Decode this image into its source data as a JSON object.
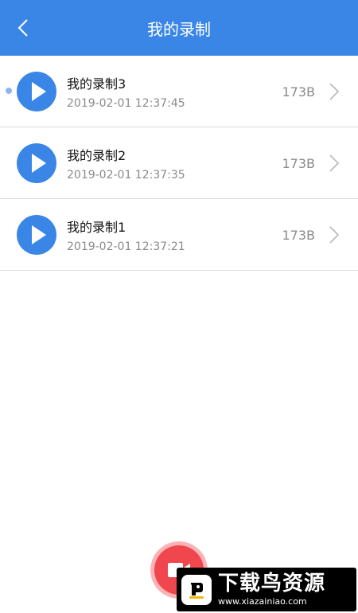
{
  "header": {
    "title": "我的录制"
  },
  "recordings": [
    {
      "name": "我的录制3",
      "time": "2019-02-01 12:37:45",
      "size": "173B"
    },
    {
      "name": "我的录制2",
      "time": "2019-02-01 12:37:35",
      "size": "173B"
    },
    {
      "name": "我的录制1",
      "time": "2019-02-01 12:37:21",
      "size": "173B"
    }
  ],
  "watermark": {
    "title": "下载鸟资源",
    "url": "www.xiazainiao.com"
  },
  "colors": {
    "accent": "#3a86e6",
    "record": "#f0464e"
  }
}
